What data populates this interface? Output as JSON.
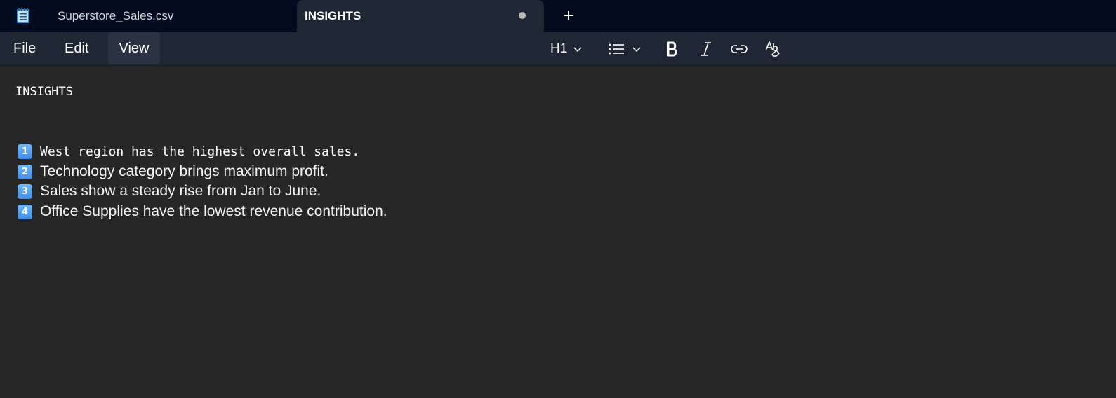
{
  "titlebar": {
    "app_icon": "notepad-icon",
    "tabs": [
      {
        "label": "Superstore_Sales.csv",
        "active": false
      },
      {
        "label": "INSIGHTS",
        "active": true,
        "unsaved": true
      }
    ],
    "new_tab_label": "+"
  },
  "menubar": {
    "items": [
      "File",
      "Edit",
      "View"
    ],
    "toolbar": {
      "heading": "H1",
      "list_icon": "bulleted-list-icon",
      "bold_icon": "bold-icon",
      "italic_icon": "italic-icon",
      "link_icon": "link-icon",
      "clear_format_icon": "clear-formatting-icon"
    }
  },
  "document": {
    "title": "INSIGHTS",
    "lines": [
      {
        "badge": "1",
        "text": "West region has the highest overall sales."
      },
      {
        "badge": "2",
        "text": "Technology category brings maximum profit."
      },
      {
        "badge": "3",
        "text": "Sales show a steady rise from Jan to June."
      },
      {
        "badge": "4",
        "text": "Office Supplies have the lowest revenue contribution."
      }
    ]
  },
  "colors": {
    "titlebar_bg": "#030b1f",
    "menubar_bg": "#1f2634",
    "editor_bg": "#272727",
    "keycap": "#4a9cf2"
  }
}
